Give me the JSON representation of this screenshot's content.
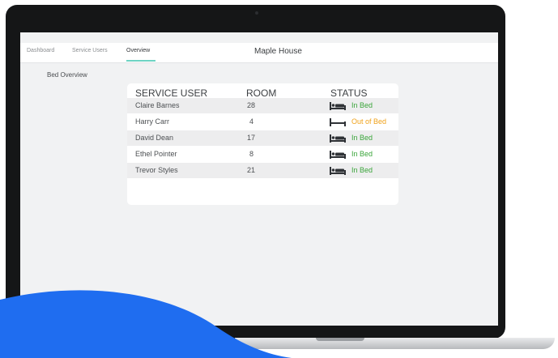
{
  "nav": {
    "tabs": [
      {
        "label": "Dashboard"
      },
      {
        "label": "Service Users"
      },
      {
        "label": "Overview"
      }
    ],
    "title": "Maple House"
  },
  "section_title": "Bed Overview",
  "table": {
    "headers": [
      "SERVICE USER",
      "ROOM",
      "STATUS"
    ],
    "rows": [
      {
        "user": "Claire Barnes",
        "room": "28",
        "status": "In Bed"
      },
      {
        "user": "Harry Carr",
        "room": "4",
        "status": "Out of Bed"
      },
      {
        "user": "David Dean",
        "room": "17",
        "status": "In Bed"
      },
      {
        "user": "Ethel Pointer",
        "room": "8",
        "status": "In Bed"
      },
      {
        "user": "Trevor Styles",
        "room": "21",
        "status": "In Bed"
      }
    ]
  },
  "colors": {
    "in_bed": "#3aa53a",
    "out_of_bed": "#f0a21a",
    "accent": "#6ed3c3",
    "blob": "#1f6df0"
  }
}
